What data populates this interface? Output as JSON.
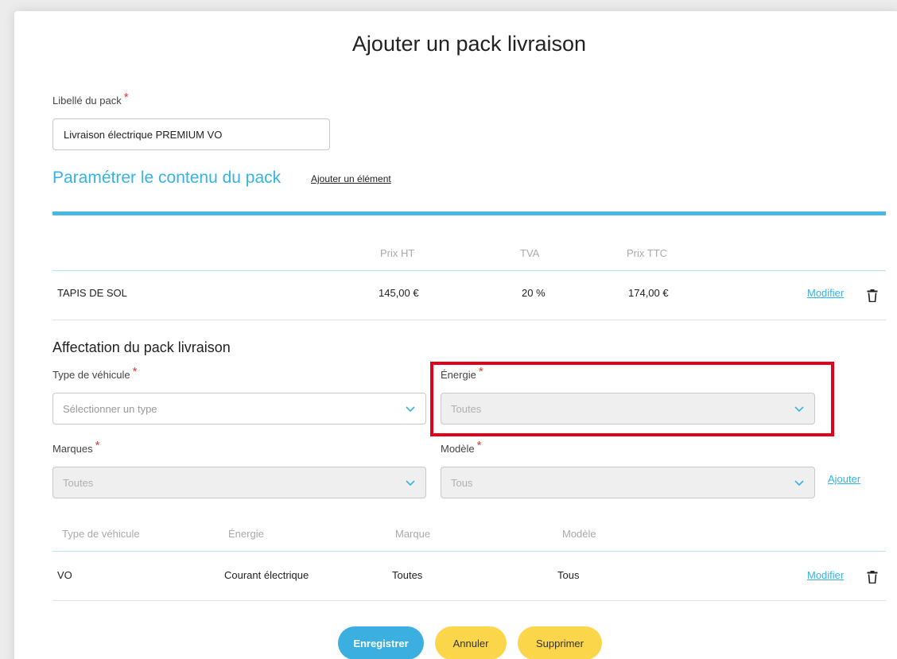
{
  "dialog": {
    "title": "Ajouter un pack livraison"
  },
  "pack_name": {
    "label": "Libellé du pack",
    "required_mark": "*",
    "value": "Livraison électrique PREMIUM VO"
  },
  "content": {
    "title": "Paramétrer le contenu du pack",
    "add_link": "Ajouter un élément",
    "columns": [
      "Prix HT",
      "TVA",
      "Prix TTC"
    ],
    "rows": [
      {
        "name": "TAPIS DE SOL",
        "prix_ht": "145,00 €",
        "tva": "20 %",
        "prix_ttc": "174,00 €",
        "edit": "Modifier"
      }
    ]
  },
  "assignment": {
    "title": "Affectation du pack livraison",
    "vehicle_type": {
      "label": "Type de véhicule",
      "required_mark": "*",
      "placeholder": "Sélectionner un type"
    },
    "energy": {
      "label": "Énergie",
      "required_mark": "*",
      "value": "Toutes"
    },
    "brands": {
      "label": "Marques",
      "required_mark": "*",
      "value": "Toutes"
    },
    "model": {
      "label": "Modèle",
      "required_mark": "*",
      "value": "Tous"
    },
    "add_link": "Ajouter",
    "columns": [
      "Type de véhicule",
      "Énergie",
      "Marque",
      "Modèle"
    ],
    "rows": [
      {
        "type": "VO",
        "energy": "Courant électrique",
        "brand": "Toutes",
        "model": "Tous",
        "edit": "Modifier"
      }
    ]
  },
  "actions": {
    "save": "Enregistrer",
    "cancel": "Annuler",
    "delete": "Supprimer"
  },
  "colors": {
    "accent": "#35b4e3",
    "primary_button": "#3bb0e0",
    "secondary_button": "#fbd64a",
    "required": "#e53935",
    "highlight": "#e3001b"
  },
  "icons": {
    "chevron": "chevron-down-icon",
    "delete": "trash-icon"
  }
}
